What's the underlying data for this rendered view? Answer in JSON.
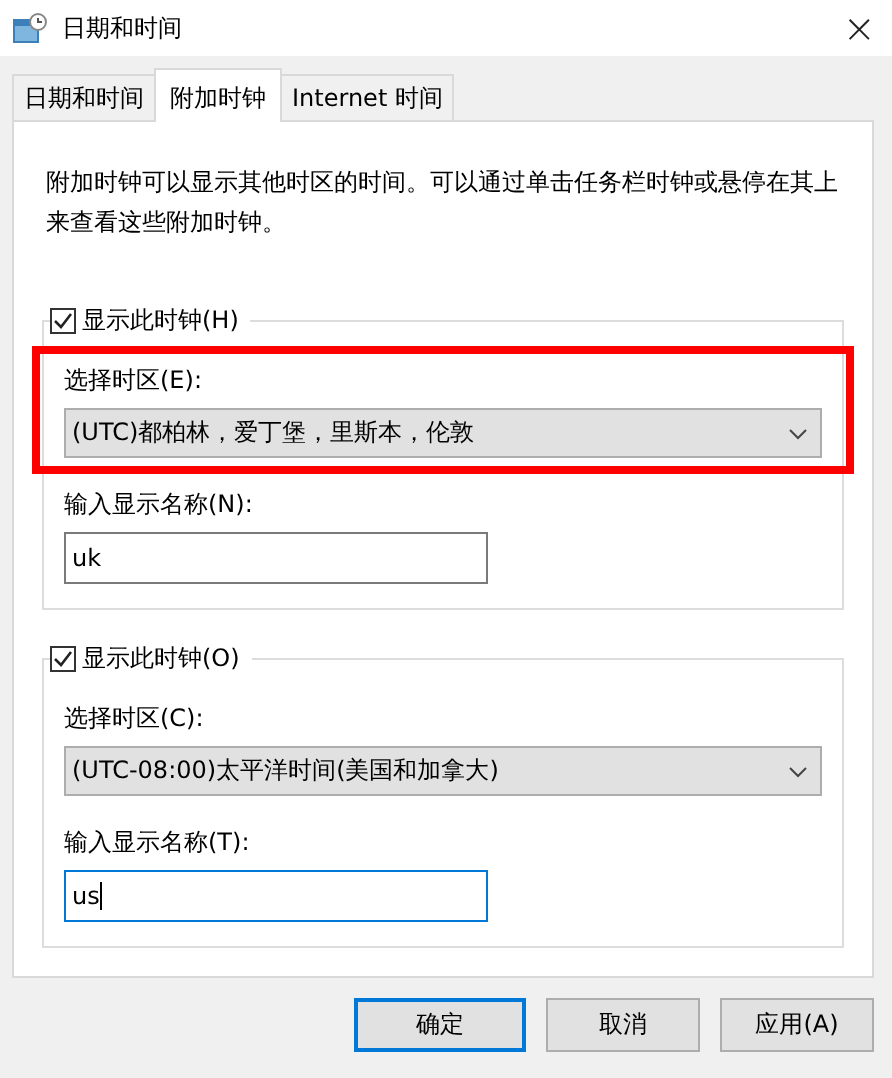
{
  "window": {
    "title": "日期和时间",
    "close": "×"
  },
  "tabs": [
    {
      "label": "日期和时间",
      "selected": false
    },
    {
      "label": "附加时钟",
      "selected": true
    },
    {
      "label": "Internet 时间",
      "selected": false
    }
  ],
  "description": "附加时钟可以显示其他时区的时间。可以通过单击任务栏时钟或悬停在其上来查看这些附加时钟。",
  "clocks": [
    {
      "show_label": "显示此时钟(H)",
      "checked": true,
      "timezone_label": "选择时区(E):",
      "timezone": "(UTC)都柏林，爱丁堡，里斯本，伦敦",
      "name_label": "输入显示名称(N):",
      "name": "uk",
      "focused": false,
      "highlighted": true
    },
    {
      "show_label": "显示此时钟(O)",
      "checked": true,
      "timezone_label": "选择时区(C):",
      "timezone": "(UTC-08:00)太平洋时间(美国和加拿大)",
      "name_label": "输入显示名称(T):",
      "name": "us",
      "focused": true,
      "highlighted": false
    }
  ],
  "buttons": [
    {
      "label": "确定",
      "default": true
    },
    {
      "label": "取消",
      "default": false
    },
    {
      "label": "应用(A)",
      "default": false
    }
  ]
}
